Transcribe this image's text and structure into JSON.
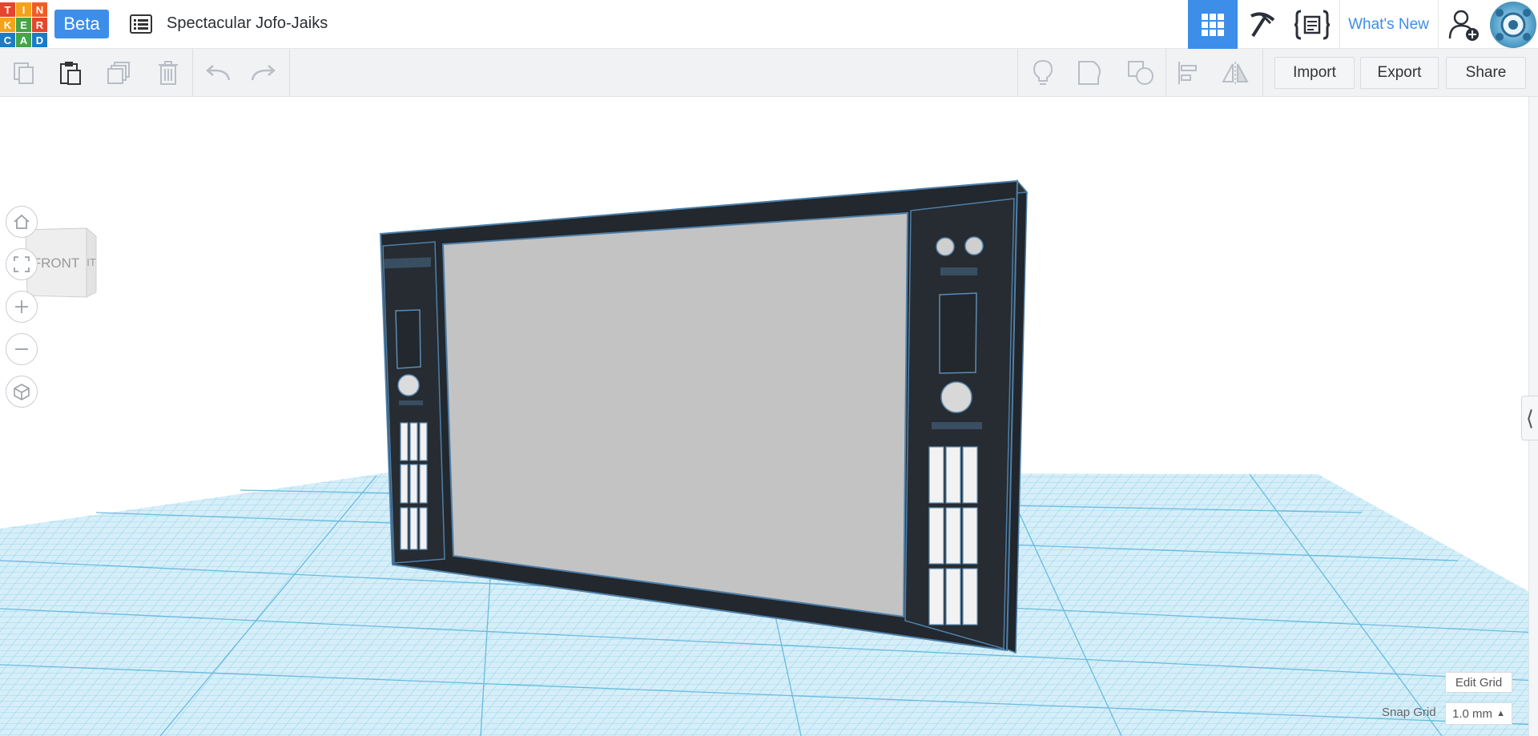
{
  "app": {
    "logo_letters": [
      "T",
      "I",
      "N",
      "K",
      "E",
      "R",
      "C",
      "A",
      "D"
    ],
    "logo_colors": [
      "#e5452f",
      "#f4a21c",
      "#f15b26",
      "#f4a21c",
      "#45a448",
      "#e5452f",
      "#1e7bc2",
      "#45a448",
      "#1e7bc2"
    ],
    "beta_label": "Beta",
    "design_title": "Spectacular Jofo-Jaiks",
    "whats_new_label": "What's New",
    "accent": "#3d8ee8"
  },
  "toolbar": {
    "import_label": "Import",
    "export_label": "Export",
    "share_label": "Share"
  },
  "viewcube": {
    "front_label": "FRONT"
  },
  "workplane": {
    "edit_grid_label": "Edit Grid",
    "snap_grid_label": "Snap Grid",
    "snap_grid_value": "1.0 mm",
    "grid_color": "#6cc2e5"
  }
}
